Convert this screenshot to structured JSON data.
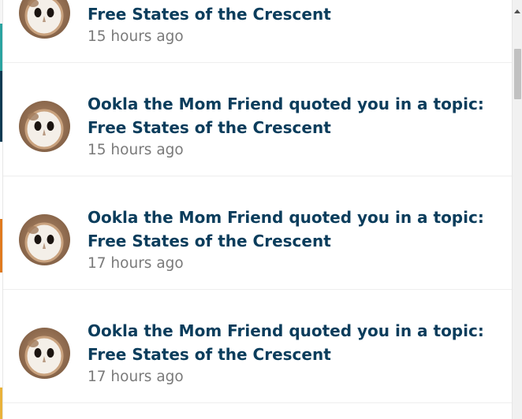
{
  "notifications": [
    {
      "title": "Ookla the Mom Friend quoted you in a topic: Free States of the Crescent",
      "time": "15 hours ago",
      "avatar": "barn-owl-avatar"
    },
    {
      "title": "Ookla the Mom Friend quoted you in a topic: Free States of the Crescent",
      "time": "15 hours ago",
      "avatar": "barn-owl-avatar"
    },
    {
      "title": "Ookla the Mom Friend quoted you in a topic: Free States of the Crescent",
      "time": "17 hours ago",
      "avatar": "barn-owl-avatar"
    },
    {
      "title": "Ookla the Mom Friend quoted you in a topic: Free States of the Crescent",
      "time": "17 hours ago",
      "avatar": "barn-owl-avatar"
    }
  ],
  "colors": {
    "title": "#0b3d5c",
    "time": "#7a7a7a",
    "divider": "#eeeeee",
    "scrollbar_track": "#f1f1f1",
    "scrollbar_thumb": "#c1c1c1"
  }
}
